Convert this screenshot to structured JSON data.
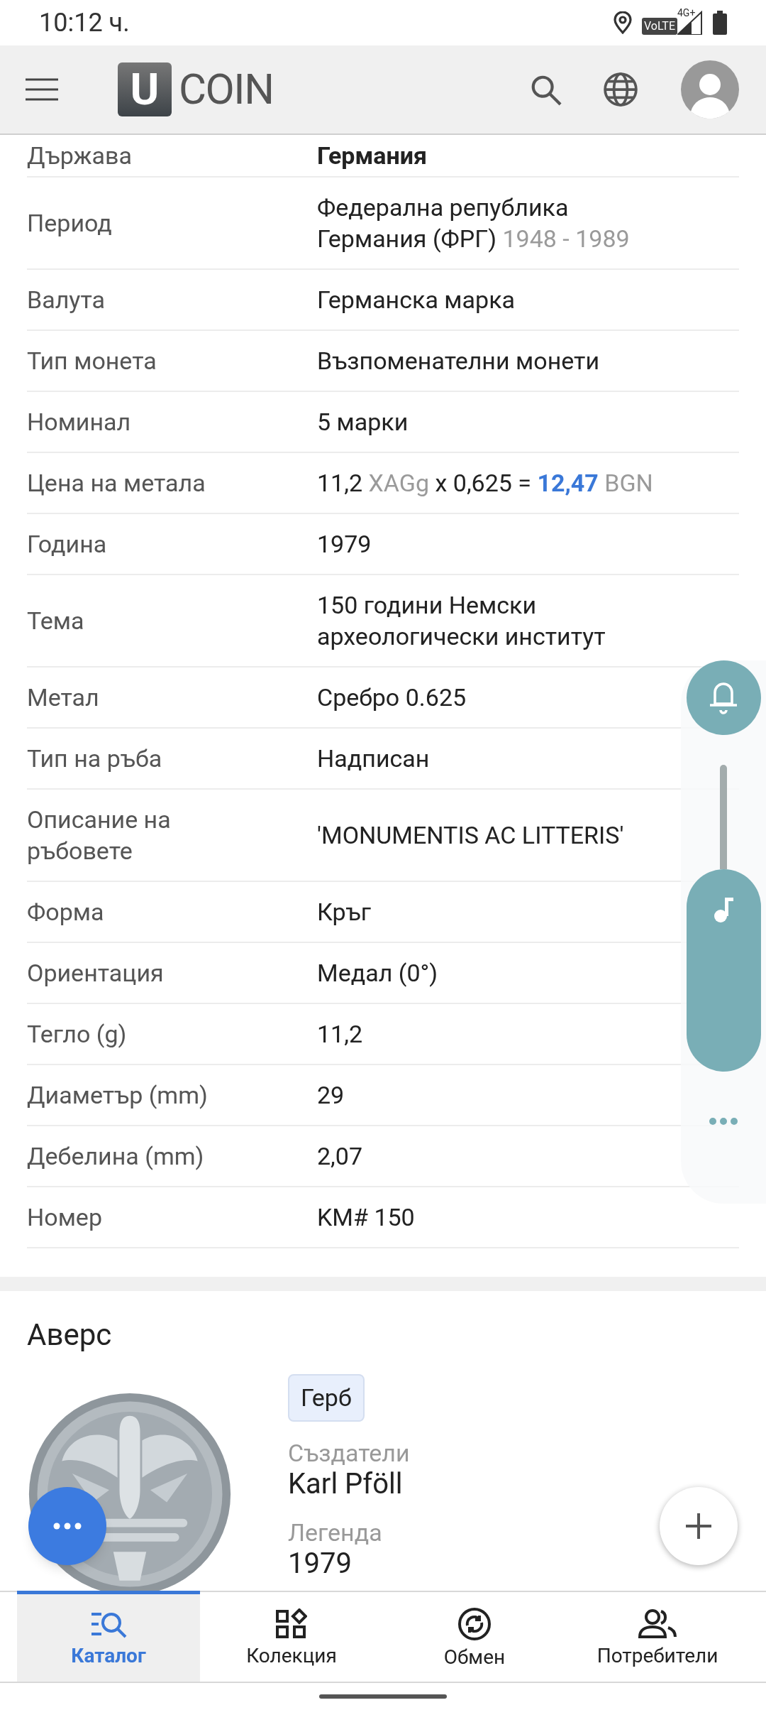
{
  "status_bar": {
    "time": "10:12 ч.",
    "volte": "VoLTE",
    "network": "4G+"
  },
  "header": {
    "logo_letter": "U",
    "logo_text": "COIN"
  },
  "details": [
    {
      "label": "Държава",
      "parts": [
        {
          "text": "Германия",
          "kind": "strong"
        }
      ]
    },
    {
      "label": "Период",
      "parts": [
        {
          "text": "Федерална република Германия (ФРГ)",
          "kind": "plain"
        },
        {
          "text": "1948 - 1989",
          "kind": "muted"
        }
      ]
    },
    {
      "label": "Валута",
      "parts": [
        {
          "text": "Германска марка",
          "kind": "plain"
        }
      ]
    },
    {
      "label": "Тип монета",
      "parts": [
        {
          "text": "Възпоменателни монети",
          "kind": "plain"
        }
      ]
    },
    {
      "label": "Номинал",
      "parts": [
        {
          "text": "5 марки",
          "kind": "plain"
        }
      ]
    },
    {
      "label": "Цена на метала",
      "parts": [
        {
          "text": "11,2",
          "kind": "plain"
        },
        {
          "text": "XAGg",
          "kind": "muted"
        },
        {
          "text": "x 0,625 =",
          "kind": "plain"
        },
        {
          "text": "12,47",
          "kind": "accent"
        },
        {
          "text": "BGN",
          "kind": "muted"
        }
      ]
    },
    {
      "label": "Година",
      "parts": [
        {
          "text": "1979",
          "kind": "plain"
        }
      ]
    },
    {
      "label": "Тема",
      "parts": [
        {
          "text": "150 години Немски археологически институт",
          "kind": "plain"
        }
      ]
    },
    {
      "label": "Метал",
      "parts": [
        {
          "text": "Сребро 0.625",
          "kind": "plain"
        }
      ]
    },
    {
      "label": "Тип на ръба",
      "parts": [
        {
          "text": "Надписан",
          "kind": "plain"
        }
      ]
    },
    {
      "label": "Описание на ръбовете",
      "parts": [
        {
          "text": "'MONUMENTIS AC LITTERIS'",
          "kind": "plain"
        }
      ]
    },
    {
      "label": "Форма",
      "parts": [
        {
          "text": "Кръг",
          "kind": "plain"
        }
      ]
    },
    {
      "label": "Ориентация",
      "parts": [
        {
          "text": "Медал (0°)",
          "kind": "plain"
        }
      ]
    },
    {
      "label": "Тегло (g)",
      "parts": [
        {
          "text": "11,2",
          "kind": "plain"
        }
      ]
    },
    {
      "label": "Диаметър (mm)",
      "parts": [
        {
          "text": "29",
          "kind": "plain"
        }
      ]
    },
    {
      "label": "Дебелина (mm)",
      "parts": [
        {
          "text": "2,07",
          "kind": "plain"
        }
      ]
    },
    {
      "label": "Номер",
      "parts": [
        {
          "text": "KM# 150",
          "kind": "plain"
        }
      ]
    }
  ],
  "volume_panel": {
    "level": 0.66
  },
  "obverse": {
    "title": "Аверс",
    "tag": "Герб",
    "fields": [
      {
        "label": "Създатели",
        "value": "Karl Pföll"
      },
      {
        "label": "Легенда",
        "value": "1979"
      }
    ]
  },
  "bottom_nav": [
    {
      "label": "Каталог",
      "selected": true
    },
    {
      "label": "Колекция",
      "selected": false
    },
    {
      "label": "Обмен",
      "selected": false
    },
    {
      "label": "Потребители",
      "selected": false
    }
  ]
}
